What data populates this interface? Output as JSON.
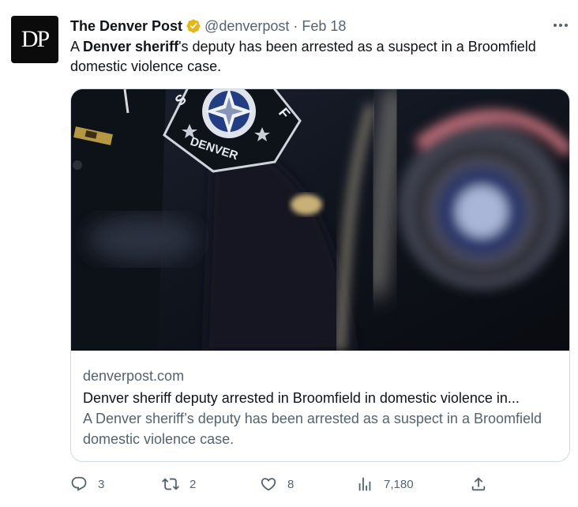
{
  "tweet": {
    "avatar_text": "DP",
    "author_name": "The Denver Post",
    "handle": "@denverpost",
    "separator": "·",
    "date": "Feb 18",
    "text_pre": "A ",
    "text_bold": "Denver sheriff",
    "text_post": "'s deputy has been arrested as a suspect in a Broomfield domestic violence case."
  },
  "card": {
    "image_alt": "Denver sheriff uniform patch",
    "patch_text_left": "S",
    "patch_text_right": "F",
    "patch_text_bottom": "DENVER",
    "domain": "denverpost.com",
    "title": "Denver sheriff deputy arrested in Broomfield in domestic violence in...",
    "description": "A Denver sheriff’s deputy has been arrested as a suspect in a Broomfield domestic violence case."
  },
  "actions": {
    "reply_count": "3",
    "retweet_count": "2",
    "like_count": "8",
    "views_count": "7,180"
  },
  "colors": {
    "verified_gold": "#e2b719",
    "secondary_text": "#536471",
    "primary_text": "#0f1419"
  },
  "icons": [
    "verified-badge-icon",
    "more-icon",
    "reply-icon",
    "retweet-icon",
    "like-icon",
    "views-icon",
    "share-icon"
  ]
}
